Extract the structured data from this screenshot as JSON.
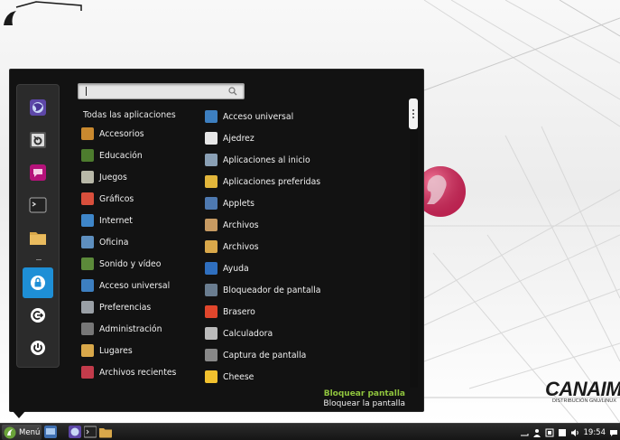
{
  "search": {
    "value": "",
    "placeholder": ""
  },
  "categories": {
    "header": "Todas las aplicaciones",
    "items": [
      {
        "label": "Accesorios",
        "icon": "accessories-icon",
        "color": "#c9892f"
      },
      {
        "label": "Educación",
        "icon": "education-icon",
        "color": "#4d7c2e"
      },
      {
        "label": "Juegos",
        "icon": "games-icon",
        "color": "#b8b8a8"
      },
      {
        "label": "Gráficos",
        "icon": "graphics-icon",
        "color": "#d84f3c"
      },
      {
        "label": "Internet",
        "icon": "internet-icon",
        "color": "#3e86c9"
      },
      {
        "label": "Oficina",
        "icon": "office-icon",
        "color": "#5e8fbf"
      },
      {
        "label": "Sonido y vídeo",
        "icon": "sound-video-icon",
        "color": "#5c8a3a"
      },
      {
        "label": "Acceso universal",
        "icon": "universal-access-icon",
        "color": "#3d7fc0"
      },
      {
        "label": "Preferencias",
        "icon": "preferences-icon",
        "color": "#9aa0a6"
      },
      {
        "label": "Administración",
        "icon": "administration-icon",
        "color": "#777777"
      },
      {
        "label": "Lugares",
        "icon": "places-folder-icon",
        "color": "#d9a84a"
      },
      {
        "label": "Archivos recientes",
        "icon": "recent-files-icon",
        "color": "#c23b4b"
      }
    ]
  },
  "apps": {
    "items": [
      {
        "label": "Acceso universal",
        "icon": "universal-access-icon",
        "color": "#3d7fc0"
      },
      {
        "label": "Ajedrez",
        "icon": "chess-icon",
        "color": "#e6e6e6"
      },
      {
        "label": "Aplicaciones al inicio",
        "icon": "startup-apps-icon",
        "color": "#8aa0b5"
      },
      {
        "label": "Aplicaciones preferidas",
        "icon": "preferred-apps-icon",
        "color": "#e2b63b"
      },
      {
        "label": "Applets",
        "icon": "applets-icon",
        "color": "#4e79b0"
      },
      {
        "label": "Archivos",
        "icon": "file-roller-icon",
        "color": "#c79a62"
      },
      {
        "label": "Archivos",
        "icon": "files-folder-icon",
        "color": "#d9a84a"
      },
      {
        "label": "Ayuda",
        "icon": "help-icon",
        "color": "#2f6fbf"
      },
      {
        "label": "Bloqueador de pantalla",
        "icon": "screensaver-icon",
        "color": "#6a7d90"
      },
      {
        "label": "Brasero",
        "icon": "brasero-icon",
        "color": "#e0462c"
      },
      {
        "label": "Calculadora",
        "icon": "calculator-icon",
        "color": "#bbbbbb"
      },
      {
        "label": "Captura de pantalla",
        "icon": "screenshot-icon",
        "color": "#888888"
      },
      {
        "label": "Cheese",
        "icon": "cheese-icon",
        "color": "#f2c12e"
      }
    ]
  },
  "description": {
    "title": "Bloquear pantalla",
    "text": "Bloquear la pantalla"
  },
  "favorites": [
    {
      "name": "fav-firefox",
      "icon": "web-browser-icon"
    },
    {
      "name": "fav-settings",
      "icon": "system-settings-icon"
    },
    {
      "name": "fav-chat",
      "icon": "chat-icon"
    },
    {
      "name": "fav-terminal",
      "icon": "terminal-icon"
    },
    {
      "name": "fav-files",
      "icon": "folder-icon"
    },
    {
      "name": "fav-lock",
      "icon": "lock-screen-icon"
    },
    {
      "name": "fav-logout",
      "icon": "logout-icon"
    },
    {
      "name": "fav-shutdown",
      "icon": "power-icon"
    }
  ],
  "taskbar": {
    "menu_label": "Menú",
    "clock": "19:54"
  },
  "wallpaper": {
    "logo_text": "CANAIMA",
    "logo_sub": "DISTRIBUCIÓN GNU/LINUX"
  },
  "colors": {
    "accent": "#1e8fd6",
    "description_title": "#8fc43d",
    "menu_bg": "#121212"
  }
}
